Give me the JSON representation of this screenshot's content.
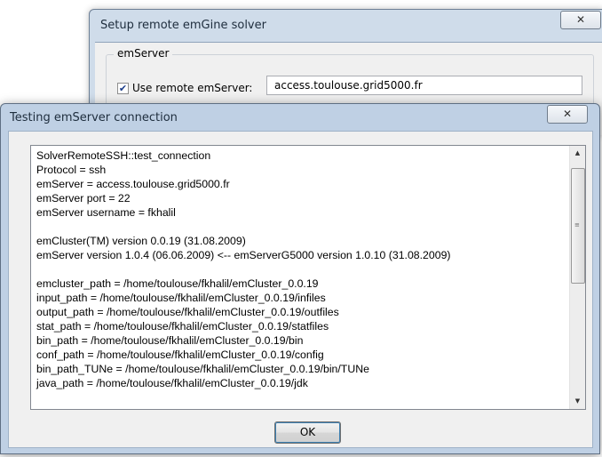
{
  "setup_window": {
    "title": "Setup remote emGine solver",
    "close_glyph": "✕",
    "group_label": "emServer",
    "use_remote_checked_glyph": "✔",
    "use_remote_label": "Use remote emServer:",
    "server_value": "access.toulouse.grid5000.fr"
  },
  "test_dialog": {
    "title": "Testing emServer connection",
    "close_glyph": "✕",
    "log_lines": [
      "SolverRemoteSSH::test_connection",
      "Protocol = ssh",
      "emServer = access.toulouse.grid5000.fr",
      "emServer port = 22",
      "emServer username = fkhalil",
      "",
      "emCluster(TM) version 0.0.19 (31.08.2009)",
      "emServer version 1.0.4 (06.06.2009) <-- emServerG5000 version 1.0.10 (31.08.2009)",
      "",
      "emcluster_path = /home/toulouse/fkhalil/emCluster_0.0.19",
      "input_path = /home/toulouse/fkhalil/emCluster_0.0.19/infiles",
      "output_path = /home/toulouse/fkhalil/emCluster_0.0.19/outfiles",
      "stat_path = /home/toulouse/fkhalil/emCluster_0.0.19/statfiles",
      "bin_path = /home/toulouse/fkhalil/emCluster_0.0.19/bin",
      "conf_path = /home/toulouse/fkhalil/emCluster_0.0.19/config",
      "bin_path_TUNe = /home/toulouse/fkhalil/emCluster_0.0.19/bin/TUNe",
      "java_path = /home/toulouse/fkhalil/emCluster_0.0.19/jdk"
    ],
    "ok_label": "OK",
    "scroll_up_glyph": "▲",
    "scroll_down_glyph": "▼",
    "scroll_grip_glyph": "≡"
  }
}
